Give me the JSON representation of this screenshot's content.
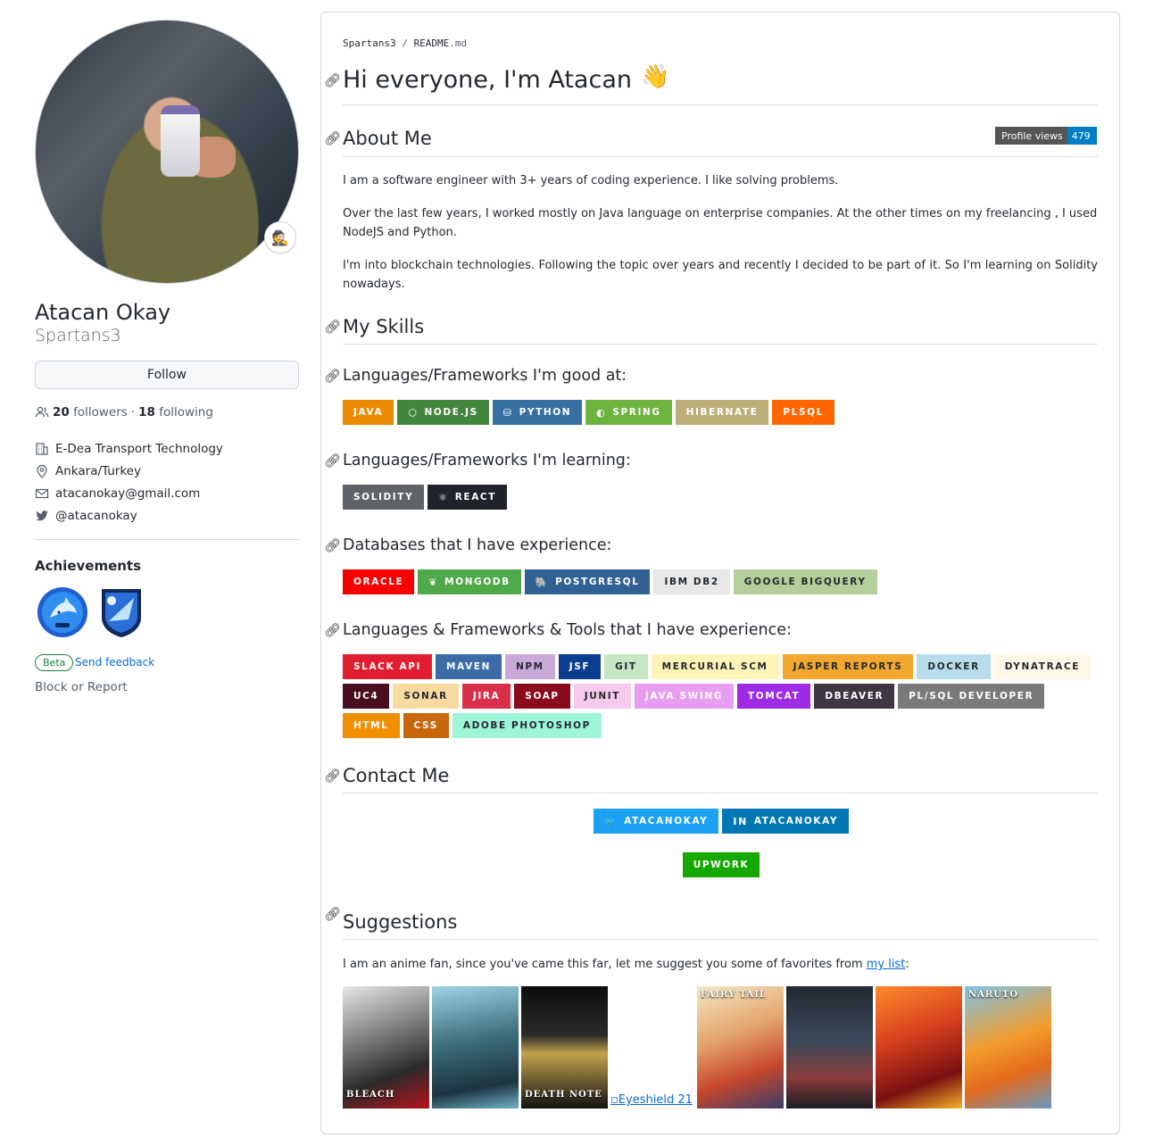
{
  "profile": {
    "full_name": "Atacan Okay",
    "username": "Spartans3",
    "follow_label": "Follow",
    "followers_count": "20",
    "followers_label": "followers",
    "separator": "·",
    "following_count": "18",
    "following_label": "following",
    "company": "E-Dea Transport Technology",
    "location": "Ankara/Turkey",
    "email": "atacanokay@gmail.com",
    "twitter": "@atacanokay",
    "achievements_title": "Achievements",
    "beta_label": "Beta",
    "feedback_label": "Send feedback",
    "block_label": "Block or Report"
  },
  "readme": {
    "crumb_user": "Spartans3",
    "crumb_sep": "/",
    "crumb_file": "README",
    "crumb_ext": ".md",
    "title": "Hi everyone, I'm Atacan",
    "wave": "👋",
    "about_title": "About Me",
    "profile_views_label": "Profile views",
    "profile_views_count": "479",
    "about_p1": "I am a software engineer with 3+ years of coding experience. I like solving problems.",
    "about_p2": "Over the last few years, I worked mostly on Java language on enterprise companies. At the other times on my freelancing , I used NodeJS and Python.",
    "about_p3": "I'm into blockchain technologies. Following the topic over years and recently I decided to be part of it. So I'm learning on Solidity nowadays.",
    "skills_title": "My Skills",
    "good_title": "Languages/Frameworks I'm good at:",
    "learning_title": "Languages/Frameworks I'm learning:",
    "db_title": "Databases that I have experience:",
    "tools_title": "Languages & Frameworks & Tools that I have experience:",
    "contact_title": "Contact Me",
    "suggestions_title": "Suggestions",
    "suggest_text": "I am an anime fan, since you've came this far, let me suggest you some of favorites from ",
    "suggest_link": "my list",
    "suggest_end": ":",
    "broken_poster_alt": "Eyeshield 21"
  },
  "badges": {
    "good": [
      {
        "label": "JAVA",
        "color": "#ED8B00",
        "icon": ""
      },
      {
        "label": "NODE.JS",
        "color": "#43853D",
        "icon": "⬡"
      },
      {
        "label": "PYTHON",
        "color": "#3670A0",
        "icon": "⛁"
      },
      {
        "label": "SPRING",
        "color": "#6DB33F",
        "icon": "◐"
      },
      {
        "label": "HIBERNATE",
        "color": "#BCAE79",
        "icon": ""
      },
      {
        "label": "PLSQL",
        "color": "#FF6600",
        "icon": ""
      }
    ],
    "learning": [
      {
        "label": "SOLIDITY",
        "color": "#5F6368",
        "icon": ""
      },
      {
        "label": "REACT",
        "color": "#20232A",
        "icon": "⚛"
      }
    ],
    "db": [
      {
        "label": "ORACLE",
        "color": "#F80000",
        "icon": ""
      },
      {
        "label": "MONGODB",
        "color": "#4EA94B",
        "icon": "❦"
      },
      {
        "label": "POSTGRESQL",
        "color": "#316192",
        "icon": "🐘"
      },
      {
        "label": "IBM DB2",
        "color": "#E8E8E8",
        "text": "#24292f",
        "icon": ""
      },
      {
        "label": "GOOGLE BIGQUERY",
        "color": "#B5CF9B",
        "text": "#24292f",
        "icon": ""
      }
    ],
    "tools": [
      {
        "label": "SLACK API",
        "color": "#E01E2F"
      },
      {
        "label": "MAVEN",
        "color": "#3B6CA8"
      },
      {
        "label": "NPM",
        "color": "#C9A9D8",
        "text": "#24292f"
      },
      {
        "label": "JSF",
        "color": "#0B3D91"
      },
      {
        "label": "GIT",
        "color": "#C7E6C4",
        "text": "#24292f"
      },
      {
        "label": "MERCURIAL SCM",
        "color": "#FFF3B8",
        "text": "#24292f"
      },
      {
        "label": "JASPER REPORTS",
        "color": "#F2A82F",
        "text": "#24292f"
      },
      {
        "label": "DOCKER",
        "color": "#B7DCEB",
        "text": "#24292f"
      },
      {
        "label": "DYNATRACE",
        "color": "#FFF8E7",
        "text": "#24292f"
      },
      {
        "label": "UC4",
        "color": "#4A0E1F"
      },
      {
        "label": "SONAR",
        "color": "#F8D9A0",
        "text": "#24292f"
      },
      {
        "label": "JIRA",
        "color": "#D92F49"
      },
      {
        "label": "SOAP",
        "color": "#8B0A1E"
      },
      {
        "label": "JUNIT",
        "color": "#F7C9EC",
        "text": "#24292f"
      },
      {
        "label": "JAVA SWING",
        "color": "#E79DF0"
      },
      {
        "label": "TOMCAT",
        "color": "#9E2BE6"
      },
      {
        "label": "DBEAVER",
        "color": "#3E3640"
      },
      {
        "label": "PL/SQL DEVELOPER",
        "color": "#7A7A7A"
      },
      {
        "label": "HTML",
        "color": "#F08F00"
      },
      {
        "label": "CSS",
        "color": "#C8670C"
      },
      {
        "label": "ADOBE PHOTOSHOP",
        "color": "#9EF5D9",
        "text": "#24292f"
      }
    ],
    "contact_row1": [
      {
        "label": "ATACANOKAY",
        "color": "#1CA1F2",
        "icon": "🐦"
      },
      {
        "label": "ATACANOKAY",
        "color": "#0077B5",
        "icon": "in"
      }
    ],
    "contact_row2": [
      {
        "label": "UPWORK",
        "color": "#14A800",
        "icon": ""
      }
    ]
  },
  "posters": [
    {
      "name": "bleach-poster",
      "bg": "linear-gradient(160deg,#e6e6e6 0%,#8a8a8a 35%,#2b2b2b 70%,#b5121b 100%)",
      "caption": "BLEACH"
    },
    {
      "name": "attack-on-titan-poster",
      "bg": "linear-gradient(170deg,#9fd3e6 0%,#3b6d7a 45%,#1c3440 80%,#6fb3c8 100%)",
      "caption": ""
    },
    {
      "name": "death-note-poster",
      "bg": "linear-gradient(180deg,#0d0d0d 0%,#2a2a2a 40%,#c2a24c 55%,#121212 100%)",
      "caption": "DEATH NOTE"
    },
    {
      "name": "eyeshield-21-poster",
      "broken": true
    },
    {
      "name": "fairy-tail-poster",
      "bg": "linear-gradient(160deg,#f3e9c6 0%,#e4a36a 40%,#c6472c 70%,#3a3d6a 100%)",
      "caption": "FAIRY TAIL"
    },
    {
      "name": "demon-slayer-poster",
      "bg": "linear-gradient(180deg,#222831 0%,#3b4a5a 45%,#8a3b3b 75%,#1a1e24 100%)",
      "caption": ""
    },
    {
      "name": "seven-deadly-sins-poster",
      "bg": "linear-gradient(160deg,#ff8a2a 0%,#d6401e 40%,#7a1010 75%,#f2b32a 100%)",
      "caption": ""
    },
    {
      "name": "naruto-poster",
      "bg": "linear-gradient(160deg,#7fc3e6 0%,#f29b2c 45%,#e36a1c 70%,#6a9ac2 100%)",
      "caption": "NARUTO"
    }
  ]
}
